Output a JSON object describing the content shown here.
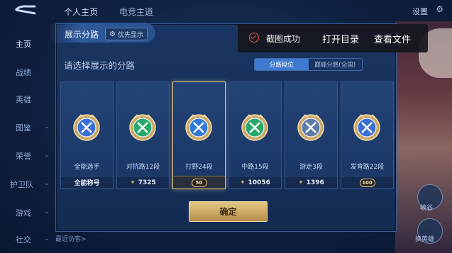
{
  "topbar": {
    "tabs": [
      "个人主页",
      "电竞主道"
    ],
    "right_label": "设置"
  },
  "sidebar": {
    "items": [
      {
        "label": "主页"
      },
      {
        "label": "战绩"
      },
      {
        "label": "英雄"
      },
      {
        "label": "图鉴"
      },
      {
        "label": "荣誉"
      },
      {
        "label": "护卫队"
      },
      {
        "label": "游戏"
      },
      {
        "label": "社交"
      }
    ]
  },
  "right_panel": {
    "label1": "峡谷",
    "label2": "换英雄"
  },
  "bottom": {
    "text": "最近访客>"
  },
  "dialog": {
    "title": "展示分路",
    "priority_label": "优先显示",
    "subtitle": "请选择展示的分路",
    "segments": [
      "分路段位",
      "巅峰分路(全国)"
    ],
    "confirm_label": "确定",
    "cards": [
      {
        "label": "全能选手",
        "foot": "全能称号",
        "type": "title",
        "color": "#3a6fd6",
        "icon": "all-round-emblem-icon"
      },
      {
        "label": "对抗路12段",
        "foot": "7325",
        "type": "score",
        "color": "#27a86a",
        "icon": "clash-lane-emblem-icon"
      },
      {
        "label": "打野24段",
        "foot": "50",
        "type": "badge",
        "color": "#2f79d8",
        "icon": "jungle-emblem-icon"
      },
      {
        "label": "中路15段",
        "foot": "10056",
        "type": "score",
        "color": "#27a86a",
        "icon": "mid-lane-emblem-icon"
      },
      {
        "label": "游走3段",
        "foot": "1396",
        "type": "score",
        "color": "#5f7ca8",
        "icon": "roam-emblem-icon"
      },
      {
        "label": "发育路22段",
        "foot": "100",
        "type": "badge",
        "color": "#3a6fd6",
        "icon": "farm-lane-emblem-icon"
      }
    ]
  },
  "toast": {
    "message": "截图成功",
    "open_dir": "打开目录",
    "view_file": "查看文件"
  }
}
